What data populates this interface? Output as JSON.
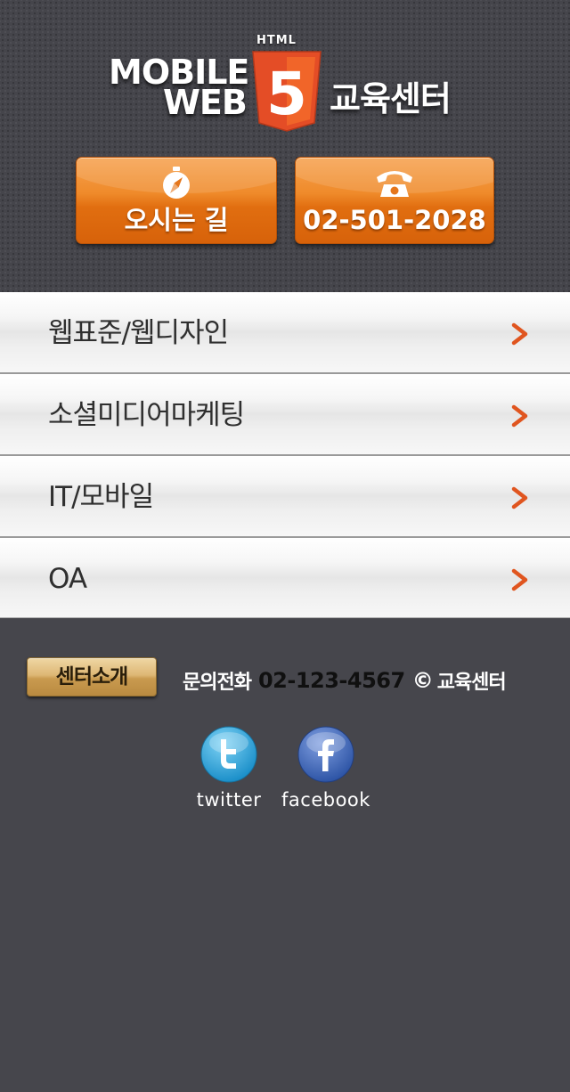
{
  "header": {
    "logo": {
      "word_mobile": "MOBILE",
      "word_web": "WEB",
      "html_badge": "HTML",
      "number": "5",
      "center_name": "교육센터"
    },
    "directions_button": {
      "label": "오시는 길",
      "icon": "compass-icon"
    },
    "phone_button": {
      "label": "02-501-2028",
      "icon": "telephone-icon"
    }
  },
  "menu": {
    "items": [
      {
        "label": "웹표준/웹디자인"
      },
      {
        "label": "소셜미디어마케팅"
      },
      {
        "label": "IT/모바일"
      },
      {
        "label": "OA"
      }
    ],
    "arrow_icon": "chevron-right-icon"
  },
  "footer": {
    "about_button": {
      "label": "센터소개"
    },
    "contact_label": "문의전화",
    "contact_phone": "02-123-4567",
    "copyright_symbol": "©",
    "copyright_name": "교육센터",
    "social": [
      {
        "label": "twitter",
        "icon": "twitter-icon"
      },
      {
        "label": "facebook",
        "icon": "facebook-icon"
      }
    ]
  },
  "colors": {
    "background": "#46464c",
    "accent_orange": "#e5761b",
    "arrow_orange": "#e0551f",
    "about_gold": "#d4ab63",
    "twitter_blue": "#29a9e1",
    "facebook_blue": "#3b66b4"
  }
}
